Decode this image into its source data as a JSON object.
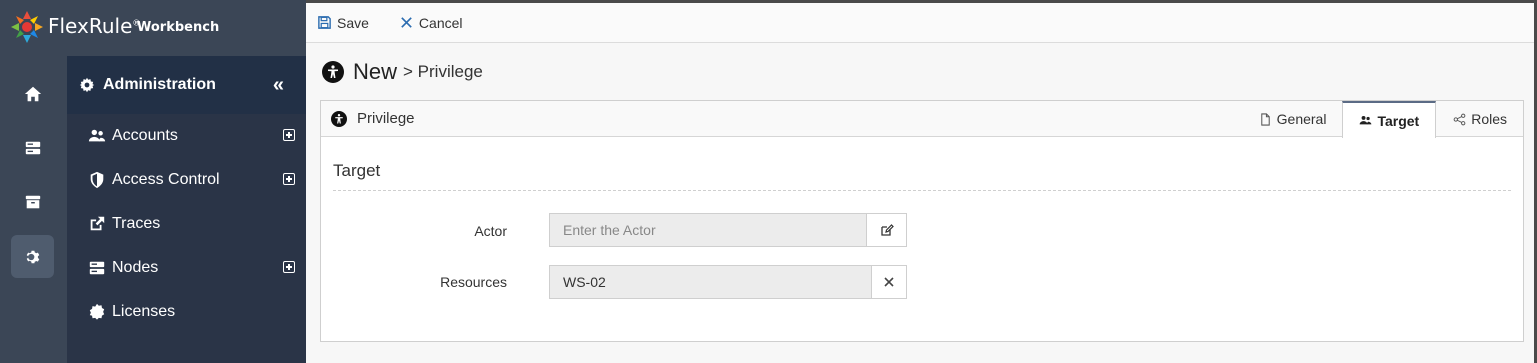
{
  "brand": {
    "name_part1": "Flex",
    "name_part2": "Rule",
    "mark": "®",
    "subtitle": "Workbench"
  },
  "rail": {
    "items": [
      {
        "icon": "home-icon",
        "active": false
      },
      {
        "icon": "server-icon",
        "active": false
      },
      {
        "icon": "archive-icon",
        "active": false
      },
      {
        "icon": "gear-icon",
        "active": true
      }
    ]
  },
  "sidebar": {
    "title": "Administration",
    "collapse_label": "«",
    "items": [
      {
        "label": "Accounts",
        "icon": "users-icon",
        "expandable": true
      },
      {
        "label": "Access Control",
        "icon": "shield-icon",
        "expandable": true
      },
      {
        "label": "Traces",
        "icon": "external-link-icon",
        "expandable": false
      },
      {
        "label": "Nodes",
        "icon": "server-icon",
        "expandable": true
      },
      {
        "label": "Licenses",
        "icon": "certificate-icon",
        "expandable": false
      }
    ]
  },
  "toolbar": {
    "save_label": "Save",
    "cancel_label": "Cancel"
  },
  "page": {
    "title": "New",
    "breadcrumb": "> Privilege"
  },
  "panel": {
    "title": "Privilege",
    "tabs": [
      {
        "label": "General",
        "icon": "file-icon",
        "active": false
      },
      {
        "label": "Target",
        "icon": "users-icon",
        "active": true
      },
      {
        "label": "Roles",
        "icon": "share-icon",
        "active": false
      }
    ],
    "section_title": "Target",
    "fields": {
      "actor": {
        "label": "Actor",
        "value": "",
        "placeholder": "Enter the Actor"
      },
      "resources": {
        "label": "Resources",
        "value": "WS-02"
      }
    }
  },
  "colors": {
    "rail_bg": "#3b4656",
    "sidebar_bg": "#2a3447",
    "sidebar_head_bg": "#223046",
    "accent_tab": "#5b6b85"
  }
}
